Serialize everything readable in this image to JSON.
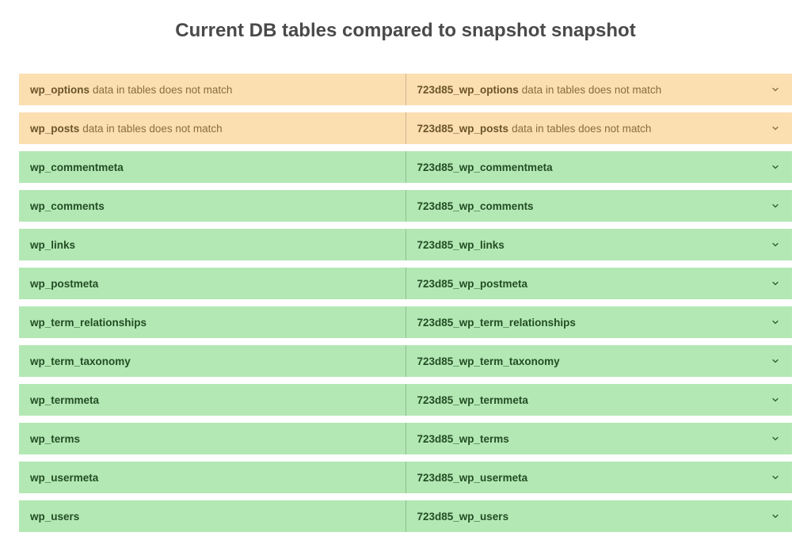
{
  "title": "Current DB tables compared to snapshot snapshot",
  "mismatch_text": "data in tables does not match",
  "rows": [
    {
      "left": "wp_options",
      "right": "723d85_wp_options",
      "status": "mismatch"
    },
    {
      "left": "wp_posts",
      "right": "723d85_wp_posts",
      "status": "mismatch"
    },
    {
      "left": "wp_commentmeta",
      "right": "723d85_wp_commentmeta",
      "status": "match"
    },
    {
      "left": "wp_comments",
      "right": "723d85_wp_comments",
      "status": "match"
    },
    {
      "left": "wp_links",
      "right": "723d85_wp_links",
      "status": "match"
    },
    {
      "left": "wp_postmeta",
      "right": "723d85_wp_postmeta",
      "status": "match"
    },
    {
      "left": "wp_term_relationships",
      "right": "723d85_wp_term_relationships",
      "status": "match"
    },
    {
      "left": "wp_term_taxonomy",
      "right": "723d85_wp_term_taxonomy",
      "status": "match"
    },
    {
      "left": "wp_termmeta",
      "right": "723d85_wp_termmeta",
      "status": "match"
    },
    {
      "left": "wp_terms",
      "right": "723d85_wp_terms",
      "status": "match"
    },
    {
      "left": "wp_usermeta",
      "right": "723d85_wp_usermeta",
      "status": "match"
    },
    {
      "left": "wp_users",
      "right": "723d85_wp_users",
      "status": "match"
    }
  ]
}
